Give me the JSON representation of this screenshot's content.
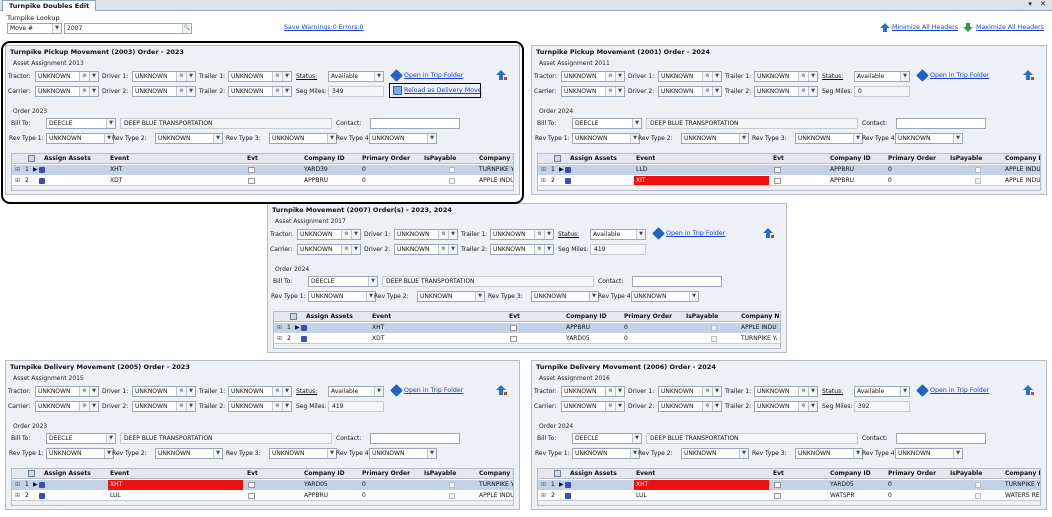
{
  "tab": {
    "title": "Turnpike Doubles Edit"
  },
  "lookup": {
    "label": "Turnpike Lookup",
    "type_value": "Move #",
    "value": "2007"
  },
  "warnings_link": "Save Warnings:0 Errors:0",
  "minimize_label": "Minimize All Headers",
  "maximize_label": "Maximize All Headers",
  "labels": {
    "asset_assignment": "Asset Assignment",
    "tractor": "Tractor:",
    "driver1": "Driver 1:",
    "trailer1": "Trailer 1:",
    "status": "Status:",
    "carrier": "Carrier:",
    "driver2": "Driver 2:",
    "trailer2": "Trailer 2:",
    "seg_miles": "Seg Miles:",
    "order": "Order",
    "bill_to": "Bill To:",
    "contact": "Contact:",
    "rev1": "Rev Type 1:",
    "rev2": "Rev Type 2:",
    "rev3": "Rev Type 3:",
    "rev4": "Rev Type 4:",
    "open_trip": "Open in Trip Folder",
    "reload": "Reload as Delivery Move"
  },
  "grid_headers": [
    "Assign Assets",
    "Event",
    "Evt",
    "Company ID",
    "Primary Order",
    "IsPayable",
    "Company N"
  ],
  "panels": [
    {
      "id": "p2003",
      "title": "Turnpike Pickup Movement (2003)    Order - 2023",
      "asset": "Asset Assignment 2013",
      "tractor": "UNKNOWN",
      "driver1": "UNKNOWN",
      "trailer1": "UNKNOWN",
      "status": "Available",
      "carrier": "UNKNOWN",
      "driver2": "UNKNOWN",
      "trailer2": "UNKNOWN",
      "seg_miles": "349",
      "order": "Order 2023",
      "bill_to": "DEECLE",
      "bill_name": "DEEP BLUE TRANSPORTATION",
      "rev1": "UNKNOWN",
      "rev2": "UNKNOWN",
      "rev3": "UNKNOWN",
      "rev4": "UNKNOWN",
      "rows": [
        {
          "n": "1",
          "event": "XHT",
          "company": "YARD39",
          "primary": "0",
          "cname": "TURNPIKE Y",
          "red": false
        },
        {
          "n": "2",
          "event": "XDT",
          "company": "APPBRU",
          "primary": "0",
          "cname": "APPLE INDU",
          "red": false
        }
      ]
    },
    {
      "id": "p2001",
      "title": "Turnpike Pickup Movement (2001)    Order - 2024",
      "asset": "Asset Assignment 2011",
      "tractor": "UNKNOWN",
      "driver1": "UNKNOWN",
      "trailer1": "UNKNOWN",
      "status": "Available",
      "carrier": "UNKNOWN",
      "driver2": "UNKNOWN",
      "trailer2": "UNKNOWN",
      "seg_miles": "0",
      "order": "Order 2024",
      "bill_to": "DEECLE",
      "bill_name": "DEEP BLUE TRANSPORTATION",
      "rev1": "UNKNOWN",
      "rev2": "UNKNOWN",
      "rev3": "UNKNOWN",
      "rev4": "UNKNOWN",
      "rows": [
        {
          "n": "1",
          "event": "LLD",
          "company": "APPBRU",
          "primary": "0",
          "cname": "APPLE INDUS",
          "red": false
        },
        {
          "n": "2",
          "event": "XIT",
          "company": "APPBRU",
          "primary": "0",
          "cname": "APPLE INDUS",
          "red": true
        }
      ]
    },
    {
      "id": "p2007",
      "title": "Turnpike Movement (2007) Order(s) - 2023, 2024",
      "asset": "Asset Assignment 2017",
      "tractor": "UNKNOWN",
      "driver1": "UNKNOWN",
      "trailer1": "UNKNOWN",
      "status": "Available",
      "carrier": "UNKNOWN",
      "driver2": "UNKNOWN",
      "trailer2": "UNKNOWN",
      "seg_miles": "419",
      "order": "Order 2024",
      "bill_to": "DEECLE",
      "bill_name": "DEEP BLUE TRANSPORTATION",
      "rev1": "UNKNOWN",
      "rev2": "UNKNOWN",
      "rev3": "UNKNOWN",
      "rev4": "UNKNOWN",
      "rows": [
        {
          "n": "1",
          "event": "XHT",
          "company": "APPBRU",
          "primary": "0",
          "cname": "APPLE INDUS",
          "red": false
        },
        {
          "n": "2",
          "event": "XDT",
          "company": "YARD05",
          "primary": "0",
          "cname": "TURNPIKE YA",
          "red": false
        }
      ]
    },
    {
      "id": "p2005",
      "title": "Turnpike Delivery Movement (2005)    Order - 2023",
      "asset": "Asset Assignment 2015",
      "tractor": "UNKNOWN",
      "driver1": "UNKNOWN",
      "trailer1": "UNKNOWN",
      "status": "Available",
      "carrier": "UNKNOWN",
      "driver2": "UNKNOWN",
      "trailer2": "UNKNOWN",
      "seg_miles": "419",
      "order": "Order 2023",
      "bill_to": "DEECLE",
      "bill_name": "DEEP BLUE TRANSPORTATION",
      "rev1": "UNKNOWN",
      "rev2": "UNKNOWN",
      "rev3": "UNKNOWN",
      "rev4": "UNKNOWN",
      "rows": [
        {
          "n": "1",
          "event": "XHT",
          "company": "YARD05",
          "primary": "0",
          "cname": "TURNPIKE YA",
          "red": true
        },
        {
          "n": "2",
          "event": "LUL",
          "company": "APPBRU",
          "primary": "0",
          "cname": "APPLE INDUS",
          "red": false
        }
      ]
    },
    {
      "id": "p2006",
      "title": "Turnpike Delivery Movement (2006)    Order - 2024",
      "asset": "Asset Assignment 2016",
      "tractor": "UNKNOWN",
      "driver1": "UNKNOWN",
      "trailer1": "UNKNOWN",
      "status": "Available",
      "carrier": "UNKNOWN",
      "driver2": "UNKNOWN",
      "trailer2": "UNKNOWN",
      "seg_miles": "392",
      "order": "Order 2024",
      "bill_to": "DEECLE",
      "bill_name": "DEEP BLUE TRANSPORTATION",
      "rev1": "UNKNOWN",
      "rev2": "UNKNOWN",
      "rev3": "UNKNOWN",
      "rev4": "UNKNOWN",
      "rows": [
        {
          "n": "1",
          "event": "XHT",
          "company": "YARD05",
          "primary": "0",
          "cname": "TURNPIKE YA",
          "red": true
        },
        {
          "n": "2",
          "event": "LUL",
          "company": "WATSPR",
          "primary": "0",
          "cname": "WATERS RES",
          "red": false
        }
      ]
    }
  ],
  "colors": {
    "link": "#1a3fd0",
    "selected_row": "#c3d2e6",
    "error_row": "#f01010"
  }
}
